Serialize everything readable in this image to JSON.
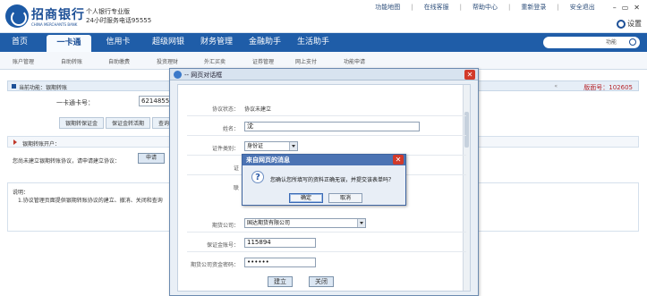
{
  "header": {
    "logo_cn": "招商银行",
    "logo_en": "CHINA MERCHANTS BANK",
    "slogan_line1": "个人银行专业版",
    "slogan_line2": "24小时服务电话95555",
    "links": [
      "功能地图",
      "在线客服",
      "帮助中心",
      "重新登录",
      "安全退出"
    ],
    "settings_label": "设置"
  },
  "main_nav": {
    "items": [
      "首页",
      "一卡通",
      "信用卡",
      "超级网银",
      "财务管理",
      "金融助手",
      "生活助手"
    ],
    "active_index": 1,
    "search_placeholder": "功能"
  },
  "sub_nav": {
    "items": [
      "账户管理",
      "自助转账",
      "自助缴费",
      "投资理财",
      "外汇买卖",
      "证券管理",
      "网上支付",
      "功能申请"
    ]
  },
  "page": {
    "current_function_label": "当前功能：",
    "current_function": "银期转账",
    "version_label": "版面号：",
    "version": "102605",
    "card_label": "一卡通卡号：",
    "card_value": "62148557",
    "tabs": [
      "银期转保证金",
      "保证金转活期",
      "查询"
    ],
    "section_title": "银期转账开户：",
    "sign_text": "您尚未建立银期转账协议，请申请建立协议：",
    "sign_button": "申请",
    "notes_title": "说明：",
    "notes_line1": "1.协议管理页面提供银期转账协议的建立、撤消、关闭和查询"
  },
  "popup": {
    "title": "-- 网页对话框",
    "protocol_status_label": "协议状态：",
    "protocol_status_value": "协议未建立",
    "name_label": "姓名：",
    "name_value": "沈",
    "id_type_label": "证件类别：",
    "id_type_value": "身份证",
    "partial_label1": "证",
    "partial_label2": "联",
    "futures_company_label": "期货公司：",
    "futures_company_value": "国达期货有限公司",
    "margin_account_label": "保证金账号：",
    "margin_account_value": "115894",
    "fund_password_label": "期货公司资金密码：",
    "fund_password_value": "••••••",
    "confirm_button": "建立",
    "close_button": "关闭"
  },
  "dialog": {
    "title": "来自网页的消息",
    "message": "您确认您所填写的资料正确无误，并提交该表单吗？",
    "ok_button": "确定",
    "cancel_button": "取消"
  }
}
